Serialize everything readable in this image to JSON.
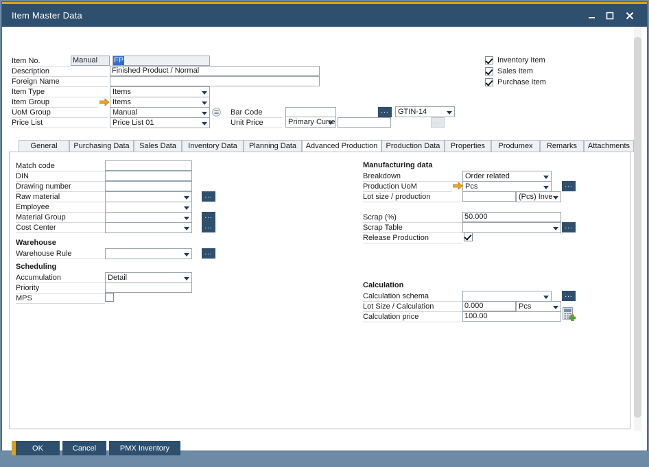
{
  "window": {
    "title": "Item Master Data",
    "controls": {
      "minimize": "minimize-icon",
      "maximize": "maximize-icon",
      "close": "close-icon"
    },
    "accent_color": "#d9a21b",
    "titlebar_color": "#2e4f6d",
    "desktop_color": "#6d8aa6"
  },
  "header": {
    "fields": [
      {
        "label": "Item No.",
        "value": "Manual",
        "value2": "FP"
      },
      {
        "label": "Description",
        "value": "Finished Product / Normal"
      },
      {
        "label": "Foreign Name",
        "value": ""
      },
      {
        "label": "Item Type",
        "value": "Items"
      },
      {
        "label": "Item Group",
        "value": "Items"
      },
      {
        "label": "UoM Group",
        "value": "Manual"
      },
      {
        "label": "Price List",
        "value": "Price List 01"
      }
    ],
    "labels": {
      "item_no": "Item No.",
      "description": "Description",
      "foreign_name": "Foreign Name",
      "item_type": "Item Type",
      "item_group": "Item Group",
      "uom_group": "UoM Group",
      "price_list": "Price List",
      "bar_code": "Bar Code",
      "unit_price": "Unit Price"
    },
    "values": {
      "item_no_manual": "Manual",
      "item_no": "FP",
      "description": "Finished Product / Normal",
      "foreign_name": "",
      "item_type": "Items",
      "item_group": "Items",
      "uom_group": "Manual",
      "price_list": "Price List 01",
      "bar_code": "",
      "gtin": "GTIN-14",
      "unit_price_currency": "Primary Curre",
      "unit_price": ""
    },
    "checkboxes": [
      {
        "label": "Inventory Item",
        "checked": true
      },
      {
        "label": "Sales Item",
        "checked": true
      },
      {
        "label": "Purchase Item",
        "checked": true
      }
    ]
  },
  "tabs": [
    {
      "label": "General",
      "active": false
    },
    {
      "label": "Purchasing Data",
      "active": false
    },
    {
      "label": "Sales Data",
      "active": false
    },
    {
      "label": "Inventory Data",
      "active": false
    },
    {
      "label": "Planning Data",
      "active": false
    },
    {
      "label": "Advanced Production",
      "active": true
    },
    {
      "label": "Production Data",
      "active": false
    },
    {
      "label": "Properties",
      "active": false
    },
    {
      "label": "Produmex",
      "active": false
    },
    {
      "label": "Remarks",
      "active": false
    },
    {
      "label": "Attachments",
      "active": false
    }
  ],
  "left_column": {
    "fields": {
      "match_code": {
        "label": "Match code",
        "value": ""
      },
      "din": {
        "label": "DIN",
        "value": ""
      },
      "drawing_number": {
        "label": "Drawing number",
        "value": ""
      },
      "raw_material": {
        "label": "Raw material",
        "value": ""
      },
      "employee": {
        "label": "Employee",
        "value": ""
      },
      "material_group": {
        "label": "Material Group",
        "value": ""
      },
      "cost_center": {
        "label": "Cost Center",
        "value": ""
      }
    },
    "warehouse": {
      "heading": "Warehouse",
      "warehouse_rule": {
        "label": "Warehouse Rule",
        "value": ""
      }
    },
    "scheduling": {
      "heading": "Scheduling",
      "accumulation": {
        "label": "Accumulation",
        "value": "Detail"
      },
      "priority": {
        "label": "Priority",
        "value": ""
      },
      "mps": {
        "label": "MPS",
        "checked": false
      }
    }
  },
  "right_column": {
    "manufacturing": {
      "heading": "Manufacturing data",
      "breakdown": {
        "label": "Breakdown",
        "value": "Order related"
      },
      "production_uom": {
        "label": "Production UoM",
        "value": "Pcs"
      },
      "lot_size_production": {
        "label": "Lot size / production",
        "value": "",
        "unit": "(Pcs) Inve"
      },
      "scrap_percent": {
        "label": "Scrap (%)",
        "value": "50.000"
      },
      "scrap_table": {
        "label": "Scrap Table",
        "value": ""
      },
      "release_production": {
        "label": "Release Production",
        "checked": true
      }
    },
    "calculation": {
      "heading": "Calculation",
      "calculation_schema": {
        "label": "Calculation schema",
        "value": ""
      },
      "lot_size_calculation": {
        "label": "Lot Size / Calculation",
        "value": "0.000",
        "unit": "Pcs"
      },
      "calculation_price": {
        "label": "Calculation price",
        "value": "100.00"
      }
    }
  },
  "footer": {
    "ok": "OK",
    "cancel": "Cancel",
    "pmx_inventory": "PMX Inventory"
  }
}
